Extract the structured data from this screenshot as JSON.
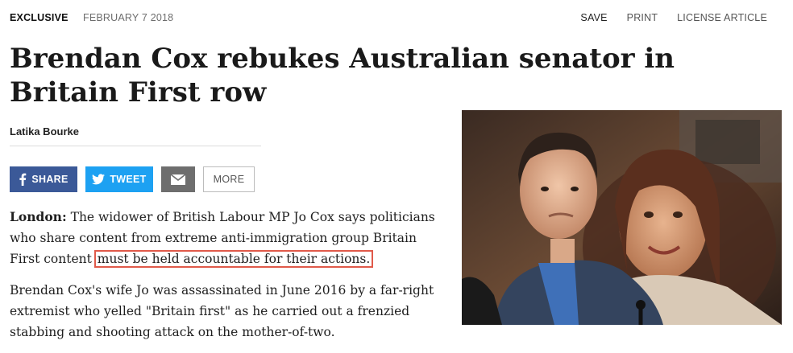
{
  "topbar": {
    "tag": "EXCLUSIVE",
    "date": "FEBRUARY 7 2018",
    "actions": [
      "SAVE",
      "PRINT",
      "LICENSE ARTICLE"
    ]
  },
  "headline": "Brendan Cox rebukes Australian senator in Britain First row",
  "byline": "Latika Bourke",
  "share": {
    "facebook": "SHARE",
    "twitter": "TWEET",
    "more": "MORE"
  },
  "article": {
    "p1_dateline": "London:",
    "p1_text": " The widower of British Labour MP Jo Cox says politicians who share content from extreme anti-immigration group Britain First content ",
    "p1_highlight": "must be held accountable for their actions.",
    "p2": "Brendan Cox's wife Jo was assassinated in June 2016 by a far-right extremist who yelled \"Britain first\" as he carried out a frenzied stabbing and shooting attack on the mother-of-two."
  },
  "colors": {
    "facebook": "#3b5998",
    "twitter": "#1da1f2",
    "email": "#6e6e6e",
    "highlight_border": "#e05a4a"
  },
  "icons": [
    "facebook-icon",
    "twitter-icon",
    "mail-icon"
  ]
}
